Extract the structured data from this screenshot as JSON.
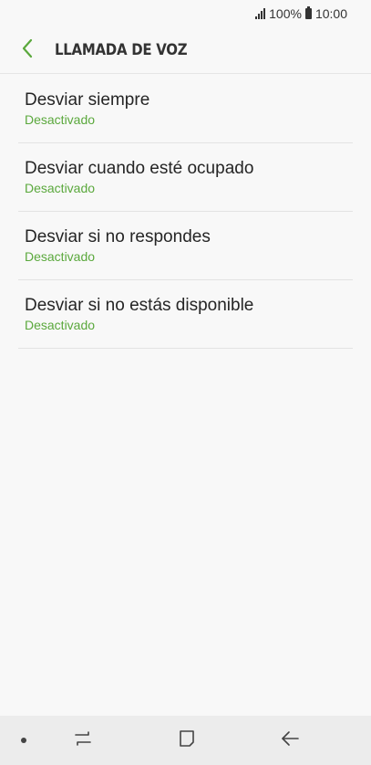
{
  "status_bar": {
    "battery": "100%",
    "time": "10:00",
    "icons": [
      "signal-icon",
      "battery-icon"
    ]
  },
  "header": {
    "title": "LLAMADA DE VOZ",
    "back_icon": "chevron-left-icon",
    "accent_color": "#5aa83c"
  },
  "list": {
    "items": [
      {
        "title": "Desviar siempre",
        "status": "Desactivado"
      },
      {
        "title": "Desviar cuando esté ocupado",
        "status": "Desactivado"
      },
      {
        "title": "Desviar si no respondes",
        "status": "Desactivado"
      },
      {
        "title": "Desviar si no estás disponible",
        "status": "Desactivado"
      }
    ]
  },
  "nav_bar": {
    "icons": [
      "dot-icon",
      "recent-apps-icon",
      "home-icon",
      "back-arrow-icon"
    ]
  }
}
